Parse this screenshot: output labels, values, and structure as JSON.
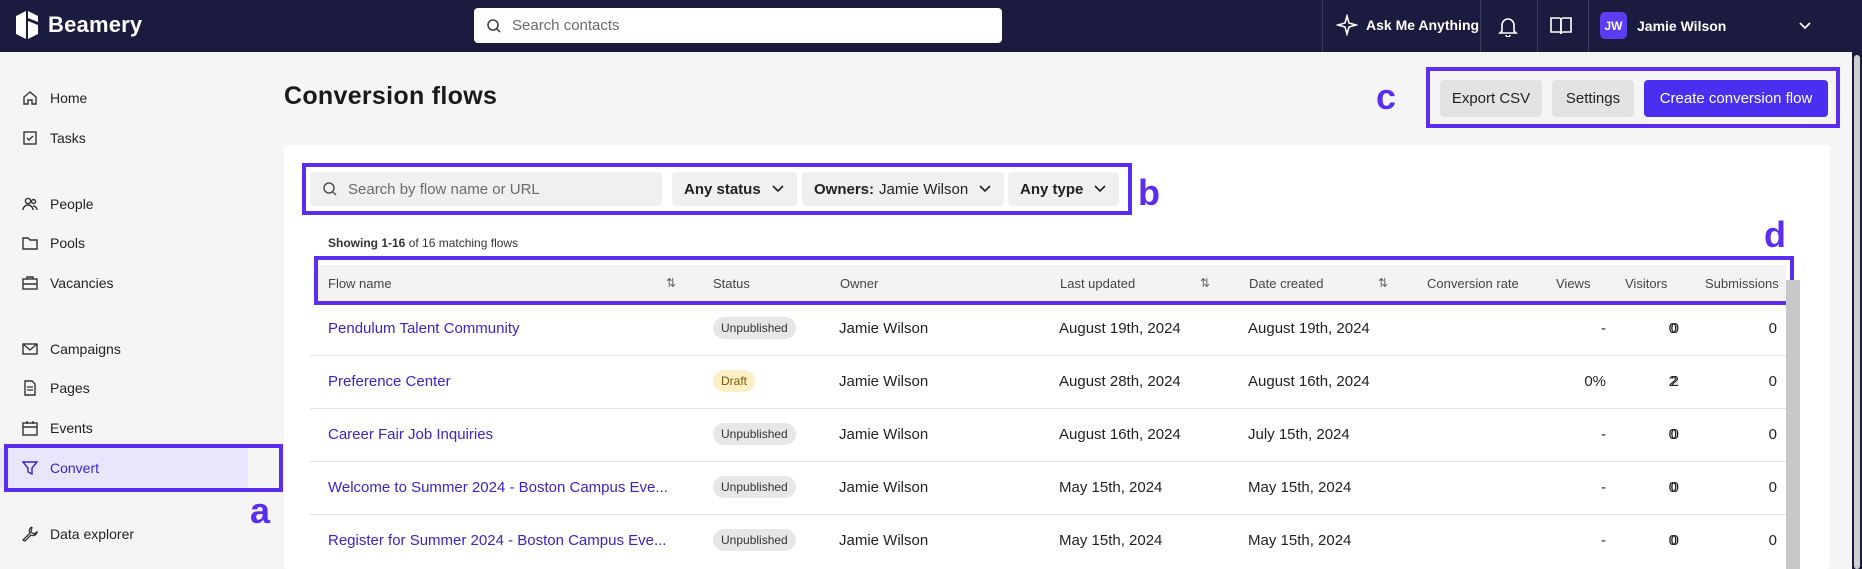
{
  "app": {
    "brand": "Beamery"
  },
  "topbar": {
    "search_placeholder": "Search contacts",
    "ask_label": "Ask Me Anything",
    "user_initials": "JW",
    "user_name": "Jamie Wilson"
  },
  "sidebar": {
    "items": [
      {
        "label": "Home",
        "icon": "home-icon"
      },
      {
        "label": "Tasks",
        "icon": "tasks-icon"
      },
      {
        "label": "People",
        "icon": "people-icon"
      },
      {
        "label": "Pools",
        "icon": "folder-icon"
      },
      {
        "label": "Vacancies",
        "icon": "briefcase-icon"
      },
      {
        "label": "Campaigns",
        "icon": "mail-icon"
      },
      {
        "label": "Pages",
        "icon": "page-icon"
      },
      {
        "label": "Events",
        "icon": "calendar-icon"
      },
      {
        "label": "Convert",
        "icon": "filter-icon",
        "active": true
      },
      {
        "label": "Data explorer",
        "icon": "wrench-icon"
      }
    ]
  },
  "page": {
    "title": "Conversion flows",
    "export_label": "Export CSV",
    "settings_label": "Settings",
    "create_label": "Create conversion flow"
  },
  "filters": {
    "search_placeholder": "Search by flow name or URL",
    "status_label": "Any status",
    "owners_prefix": "Owners:",
    "owners_value": "Jamie Wilson",
    "type_label": "Any type"
  },
  "results": {
    "showing_range": "Showing 1-16",
    "showing_rest": "of 16 matching flows"
  },
  "table": {
    "columns": [
      "Flow name",
      "Status",
      "Owner",
      "Last updated",
      "Date created",
      "Conversion rate",
      "Views",
      "Visitors",
      "Submissions"
    ],
    "rows": [
      {
        "name": "Pendulum Talent Community",
        "status": "Unpublished",
        "owner": "Jamie Wilson",
        "updated": "August 19th, 2024",
        "created": "August 19th, 2024",
        "rate": "-",
        "views": "0",
        "visitors": "0",
        "submissions": "0"
      },
      {
        "name": "Preference Center",
        "status": "Draft",
        "owner": "Jamie Wilson",
        "updated": "August 28th, 2024",
        "created": "August 16th, 2024",
        "rate": "0%",
        "views": "2",
        "visitors": "2",
        "submissions": "0"
      },
      {
        "name": "Career Fair Job Inquiries",
        "status": "Unpublished",
        "owner": "Jamie Wilson",
        "updated": "August 16th, 2024",
        "created": "July 15th, 2024",
        "rate": "-",
        "views": "0",
        "visitors": "0",
        "submissions": "0"
      },
      {
        "name": "Welcome to Summer 2024 - Boston Campus Eve...",
        "status": "Unpublished",
        "owner": "Jamie Wilson",
        "updated": "May 15th, 2024",
        "created": "May 15th, 2024",
        "rate": "-",
        "views": "0",
        "visitors": "0",
        "submissions": "0"
      },
      {
        "name": "Register for Summer 2024 - Boston Campus Eve...",
        "status": "Unpublished",
        "owner": "Jamie Wilson",
        "updated": "May 15th, 2024",
        "created": "May 15th, 2024",
        "rate": "-",
        "views": "0",
        "visitors": "0",
        "submissions": "0"
      }
    ]
  },
  "annotations": {
    "a": "a",
    "b": "b",
    "c": "c",
    "d": "d"
  },
  "colors": {
    "topbar": "#1b1a3f",
    "accent": "#4a2ff0",
    "annotation": "#5b2df0",
    "link": "#3d23c8"
  }
}
